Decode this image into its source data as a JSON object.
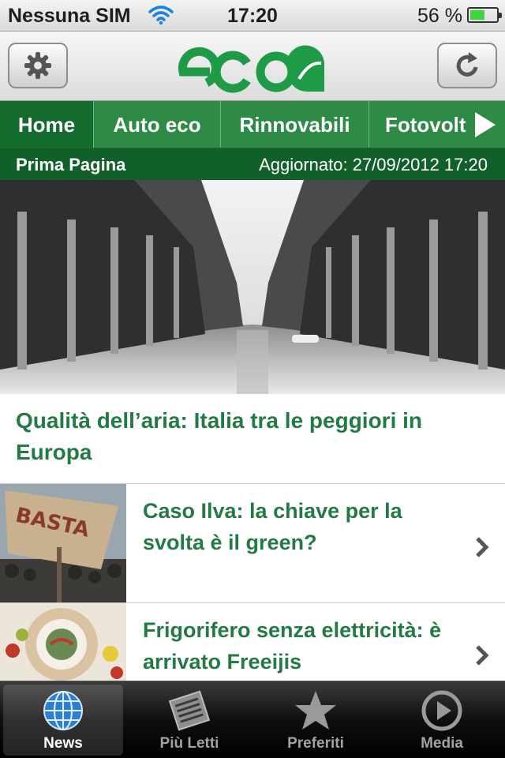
{
  "status_bar": {
    "carrier": "Nessuna SIM",
    "time": "17:20",
    "battery": "56 %",
    "battery_level": 0.56
  },
  "header": {
    "logo_text": "ecoo",
    "settings_icon": "gear-icon",
    "refresh_icon": "refresh-icon",
    "brand_color": "#1f9b48"
  },
  "tabs": [
    {
      "label": "Home",
      "active": true
    },
    {
      "label": "Auto eco",
      "active": false
    },
    {
      "label": "Rinnovabili",
      "active": false
    },
    {
      "label": "Fotovolt",
      "active": false
    }
  ],
  "subheader": {
    "section": "Prima Pagina",
    "updated": "Aggiornato: 27/09/2012 17:20"
  },
  "hero": {
    "title": "Qualità dell’aria: Italia tra le peggiori in Europa"
  },
  "articles": [
    {
      "title": "Caso Ilva: la chiave per la svolta è il green?",
      "thumb_text": "BASTA"
    },
    {
      "title": "Frigorifero senza elettricità: è arrivato Freeijis"
    }
  ],
  "tab_bar": [
    {
      "label": "News",
      "icon": "globe-icon",
      "active": true
    },
    {
      "label": "Più Letti",
      "icon": "newspaper-icon",
      "active": false
    },
    {
      "label": "Preferiti",
      "icon": "star-icon",
      "active": false
    },
    {
      "label": "Media",
      "icon": "play-icon",
      "active": false
    }
  ],
  "colors": {
    "tab_green": "#2e8b46",
    "tab_active": "#146b2e",
    "headline_green": "#237a44"
  }
}
